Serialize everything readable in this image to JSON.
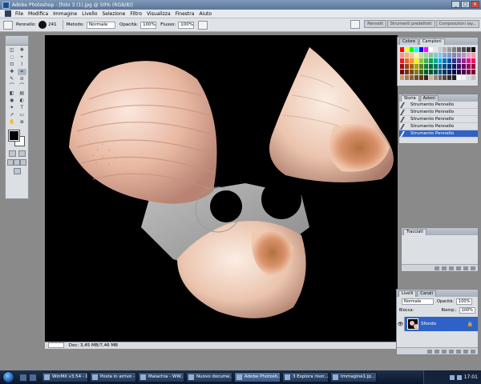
{
  "titlebar": {
    "title": "Adobe Photoshop - [foto 3 (1).jpg @ 50% (RGB/8)]"
  },
  "menu": [
    "File",
    "Modifica",
    "Immagine",
    "Livello",
    "Selezione",
    "Filtro",
    "Visualizza",
    "Finestra",
    "Aiuto"
  ],
  "options": {
    "tool_label": "Pennello:",
    "brush_size": "241",
    "mode_label": "Metodo:",
    "mode_value": "Normale",
    "opacity_label": "Opacità:",
    "opacity_value": "100%",
    "flow_label": "Flusso:",
    "flow_value": "100%"
  },
  "palette_well": [
    "Pennelli",
    "Strumenti predefiniti",
    "Composizioni lay..."
  ],
  "tools": [
    "◫",
    "✥",
    "◌",
    "⌖",
    "⊡",
    "⌇",
    "✚",
    "⌗",
    "✎",
    "⊘",
    "⌒",
    "⌒",
    "◧",
    "▤",
    "◉",
    "◐",
    "✦",
    "T",
    "➚",
    "▭",
    "✋",
    "⊕"
  ],
  "color_panel": {
    "tabs": [
      "Colore",
      "Campioni"
    ],
    "swatches": [
      "#ff0000",
      "#ffff00",
      "#00ff00",
      "#00ffff",
      "#0000ff",
      "#ff00ff",
      "#ffffff",
      "#e6e6e6",
      "#cccccc",
      "#b3b3b3",
      "#999999",
      "#808080",
      "#666666",
      "#4d4d4d",
      "#333333",
      "#000000",
      "#f7977a",
      "#f9ad81",
      "#fdc68a",
      "#fff79a",
      "#c4df9b",
      "#a2d39c",
      "#82ca9d",
      "#7bcdc8",
      "#6ecff6",
      "#7ea7d8",
      "#8493ca",
      "#8882be",
      "#a187be",
      "#bc8dbf",
      "#f49ac2",
      "#f6989d",
      "#ed1c24",
      "#f26522",
      "#f7941d",
      "#fff200",
      "#8dc63f",
      "#39b54a",
      "#00a651",
      "#00a99d",
      "#00aeef",
      "#0072bc",
      "#0054a6",
      "#2e3192",
      "#662d91",
      "#92278f",
      "#ec008c",
      "#ed145b",
      "#9e0b0f",
      "#a0410d",
      "#a36209",
      "#aba000",
      "#598527",
      "#1a7b30",
      "#007236",
      "#00746b",
      "#0076a3",
      "#004b80",
      "#003471",
      "#1b1464",
      "#440e62",
      "#630460",
      "#9e005d",
      "#9e0039",
      "#790000",
      "#7b2e00",
      "#7d4900",
      "#827b00",
      "#406618",
      "#005e20",
      "#005826",
      "#005952",
      "#005b7f",
      "#003663",
      "#002157",
      "#0d004c",
      "#32004b",
      "#4b0049",
      "#7b0046",
      "#7a0026",
      "#c69c6d",
      "#a67c52",
      "#8c6239",
      "#754c24",
      "#603913",
      "#3c2415",
      "#c7b299",
      "#998675",
      "#736357",
      "#534741",
      "#362f2d",
      "#1e1e1e",
      "#ffffff",
      "#f2f2f2",
      "#d9d9d9",
      "#bfbfbf"
    ]
  },
  "history_panel": {
    "tabs": [
      "Storia",
      "Azioni"
    ],
    "items": [
      {
        "label": "Strumento Pennello",
        "active": false
      },
      {
        "label": "Strumento Pennello",
        "active": false
      },
      {
        "label": "Strumento Pennello",
        "active": false
      },
      {
        "label": "Strumento Pennello",
        "active": false
      },
      {
        "label": "Strumento Pennello",
        "active": true
      }
    ]
  },
  "channels_panel": {
    "tabs": [
      "Tracciati"
    ]
  },
  "layers_panel": {
    "tabs": [
      "Livelli",
      "Canali"
    ],
    "blend_mode": "Normale",
    "opacity_label": "Opacità:",
    "opacity_value": "100%",
    "lock_label": "Blocca:",
    "fill_label": "Riemp.:",
    "fill_value": "100%",
    "layer_name": "Sfondo"
  },
  "doc_status": {
    "zoom": "50%",
    "info": "Doc: 3,45 MB/7,46 MB"
  },
  "taskbar": {
    "buttons": [
      {
        "label": "WinMX v3.54 - Con...",
        "active": false
      },
      {
        "label": "Posta in arrivo - ...",
        "active": false
      },
      {
        "label": "Malachia - WW...",
        "active": false
      },
      {
        "label": "Nuovo docume...",
        "active": false
      },
      {
        "label": "Adobe Photosh...",
        "active": true
      },
      {
        "label": "3 Esplora risor...",
        "active": false
      },
      {
        "label": "Immagine1.jp...",
        "active": false
      }
    ],
    "clock": "17:01"
  }
}
